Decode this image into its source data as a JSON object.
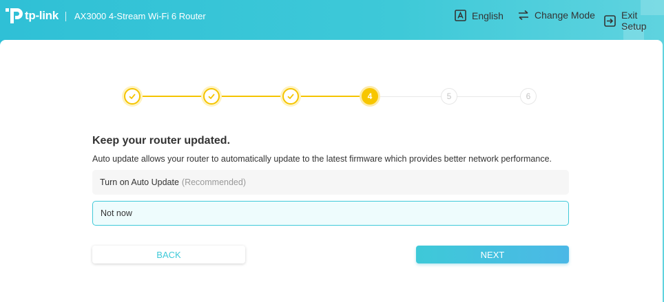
{
  "header": {
    "logo_text": "tp-link",
    "product_name": "AX3000 4-Stream Wi-Fi 6 Router",
    "nav": {
      "language": "English",
      "change_mode": "Change Mode",
      "exit_setup": "Exit Setup"
    }
  },
  "stepper": {
    "current_step": 4,
    "steps": [
      {
        "label": "1",
        "state": "done"
      },
      {
        "label": "2",
        "state": "done"
      },
      {
        "label": "3",
        "state": "done"
      },
      {
        "label": "4",
        "state": "current"
      },
      {
        "label": "5",
        "state": "todo"
      },
      {
        "label": "6",
        "state": "todo"
      }
    ]
  },
  "content": {
    "title": "Keep your router updated.",
    "description": "Auto update allows your router to automatically update to the latest firmware which provides better network performance.",
    "options": [
      {
        "label": "Turn on Auto Update",
        "note": "(Recommended)",
        "selected": false
      },
      {
        "label": "Not now",
        "note": "",
        "selected": true
      }
    ]
  },
  "buttons": {
    "back": "BACK",
    "next": "NEXT"
  },
  "colors": {
    "brand": "#3ec9d8",
    "step_accent": "#f7c600",
    "step_inactive": "#e6e6e6"
  }
}
